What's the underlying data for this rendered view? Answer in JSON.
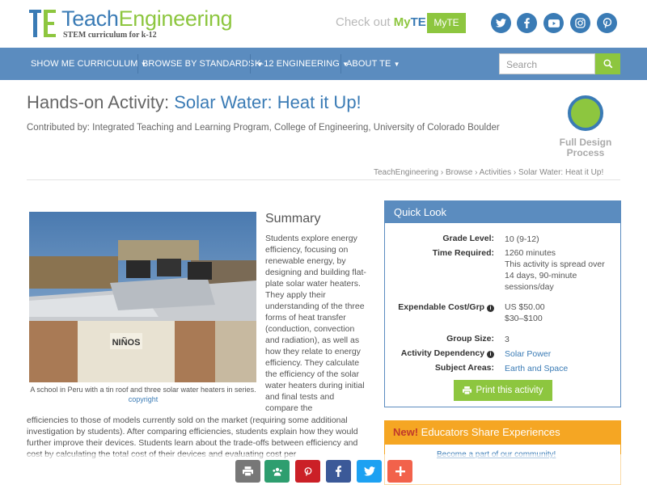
{
  "header": {
    "logo_part1": "Teach",
    "logo_part2": "Engineering",
    "logo_subtitle": "STEM curriculum for k-12",
    "checkout_prefix": "Check out ",
    "checkout_my": "My",
    "checkout_te": "TE",
    "myte_button": "MyTE",
    "social": [
      "twitter",
      "facebook",
      "youtube",
      "instagram",
      "pinterest"
    ]
  },
  "nav": {
    "items": [
      "SHOW ME CURRICULUM",
      "BROWSE BY STANDARDS",
      "K-12 ENGINEERING",
      "ABOUT TE"
    ],
    "search_placeholder": "Search"
  },
  "page": {
    "title_prefix": "Hands-on Activity: ",
    "title_main": "Solar Water: Heat it Up!",
    "contributed": "Contributed by: Integrated Teaching and Learning Program, College of Engineering, University of Colorado Boulder",
    "fdp_line1": "Full Design",
    "fdp_line2": "Process",
    "breadcrumbs": [
      "TeachEngineering",
      "Browse",
      "Activities",
      "Solar Water: Heat it Up!"
    ]
  },
  "image": {
    "caption": "A school in Peru with a tin roof and three solar water heaters in series.",
    "copyright": "copyright",
    "sign_text": "NIÑOS"
  },
  "summary": {
    "heading": "Summary",
    "col_text": "Students explore energy efficiency, focusing on renewable energy, by designing and building flat-plate solar water heaters. They apply their understanding of the three forms of heat transfer (conduction, convection and radiation), as well as how they relate to energy efficiency. They calculate the efficiency of the solar water heaters during initial and final tests and compare the",
    "full_text": "efficiencies to those of models currently sold on the market (requiring some additional investigation by students). After comparing efficiencies, students explain how they would further improve their devices. Students learn about the trade-offs between efficiency and cost by calculating the total cost of their devices and evaluating cost per"
  },
  "quicklook": {
    "title": "Quick Look",
    "grade_label": "Grade Level:",
    "grade_value": "10 (9-12)",
    "time_label": "Time Required:",
    "time_value": "1260 minutes",
    "time_note": "This activity is spread over 14 days, 90-minute sessions/day",
    "cost_label": "Expendable Cost/Grp",
    "cost_value": "US $50.00",
    "cost_range": "$30–$100",
    "group_label": "Group Size:",
    "group_value": "3",
    "dep_label": "Activity Dependency",
    "dep_value": "Solar Power",
    "subject_label": "Subject Areas:",
    "subject_value": "Earth and Space",
    "print_label": "Print this activity"
  },
  "educators": {
    "new": "New!",
    "title": " Educators Share Experiences",
    "link": "Become a part of our community!"
  },
  "share": [
    "print",
    "classroom",
    "pinterest",
    "facebook",
    "twitter",
    "more"
  ],
  "colors": {
    "blue": "#3a7bb5",
    "nav_blue": "#5b8cbf",
    "green": "#8dc63f",
    "orange": "#f5a623"
  }
}
